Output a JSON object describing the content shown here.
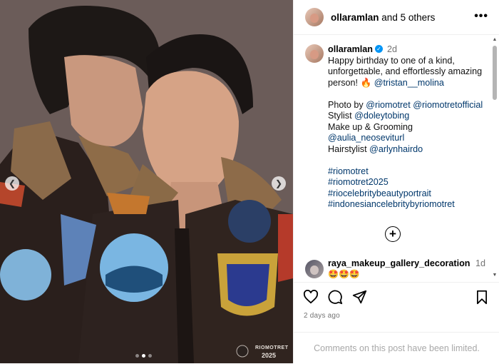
{
  "post": {
    "dots_total": 3,
    "dots_active": 1
  },
  "header": {
    "author": "ollaramlan",
    "others": "and 5 others"
  },
  "caption": {
    "username": "ollaramlan",
    "age": "2d",
    "line1": "Happy birthday to one of a kind, unforgettable, and effortlessly amazing person!",
    "emoji": "🔥",
    "mention_tristan": "@tristan__molina",
    "photo_label": "Photo by",
    "photo_m1": "@riomotret",
    "photo_m2": "@riomotretofficial",
    "stylist_label": "Stylist",
    "stylist_m": "@doleytobing",
    "makeup_label": "Make up & Grooming",
    "makeup_m": "@aulia_neoseviturl",
    "hair_label": "Hairstylist",
    "hair_m": "@arlynhairdo",
    "tags": [
      "#riomotret",
      "#riomotret2025",
      "#riocelebritybeautyportrait",
      "#indonesiancelebritybyriomotret"
    ]
  },
  "comment": {
    "username": "raya_makeup_gallery_decoration",
    "age": "1d",
    "text": "🤩🤩🤩"
  },
  "timestamp": "2 days ago",
  "footer": "Comments on this post have been limited.",
  "watermark": {
    "brand": "RIOMOTRET",
    "year": "2025"
  },
  "colors": {
    "link": "#00376b",
    "verified": "#0095f6",
    "muted": "#737373"
  }
}
